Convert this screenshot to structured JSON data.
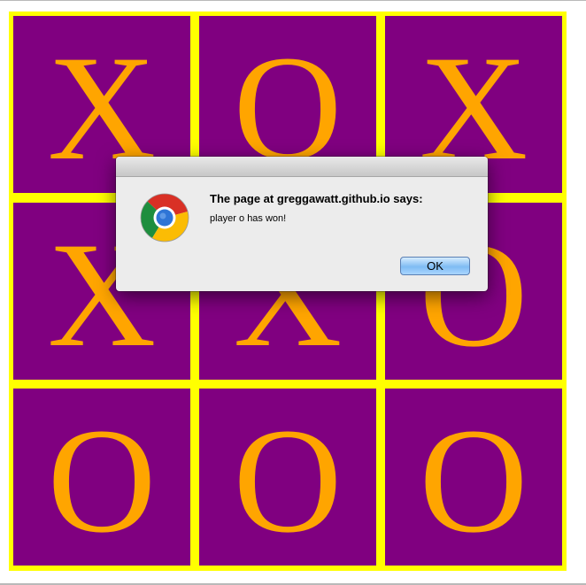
{
  "board": {
    "cells": [
      {
        "mark": "X"
      },
      {
        "mark": "O"
      },
      {
        "mark": "X"
      },
      {
        "mark": "X"
      },
      {
        "mark": "X"
      },
      {
        "mark": "O"
      },
      {
        "mark": "O"
      },
      {
        "mark": "O"
      },
      {
        "mark": "O"
      }
    ],
    "colors": {
      "grid_lines": "#ffff00",
      "cell_background": "#800080",
      "mark": "#ffa500"
    }
  },
  "alert": {
    "title": "The page at greggawatt.github.io says:",
    "message": "player o has won!",
    "ok_label": "OK",
    "icon": "chrome-logo-icon"
  }
}
